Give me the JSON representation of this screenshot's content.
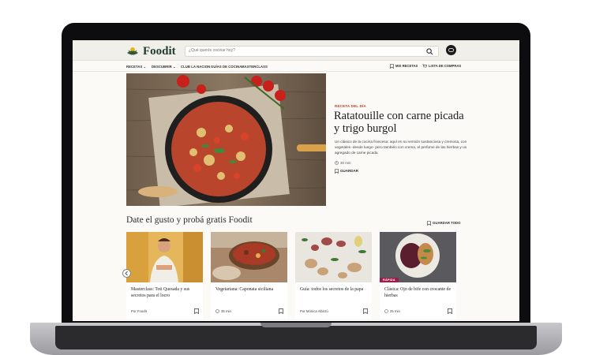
{
  "brand": {
    "name": "Foodit"
  },
  "search": {
    "placeholder": "¿Qué querés cocinar hoy?"
  },
  "nav": {
    "items": [
      "RECETAS",
      "DESCUBRIR",
      "CLUB LA NACION",
      "GUÍAS DE COCINA",
      "MASTERCLASS"
    ],
    "my_recipes": "MIS RECETAS",
    "shopping_list": "LISTA DE COMPRAS"
  },
  "hero": {
    "kicker": "RECETA DEL DÍA",
    "title": "Ratatouille con carne picada y trigo burgol",
    "description": "Un clásico de la cocina francesa: aquí en su versión sustanciosa y cremosa, con vegetales -desde luego- pero también con crema, el perfume de las hierbas y un agregado de carne picada",
    "time": "30 min",
    "save_label": "GUARDAR"
  },
  "section": {
    "title": "Date el gusto y probá gratis Foodit",
    "save_all": "GUARDAR TODO"
  },
  "cards": [
    {
      "title": "Masterclass: Toti Quesada y sus secretos para el locro",
      "meta": "Por Foodit"
    },
    {
      "title": "Vegetariana: Caponata siciliana",
      "meta": "35 min"
    },
    {
      "title": "Guía: todos los secretos de la papa",
      "meta": "Por Mónica Albirzú"
    },
    {
      "title": "Clásica: Ojo de bife con crocante de hierbas",
      "meta": "25 min",
      "badge": "RÁPIDA"
    }
  ],
  "colors": {
    "accent_red": "#b5402e",
    "brand_green": "#1f3d2b",
    "badge_magenta": "#9b1f4a"
  },
  "icons": [
    "logo-leaf-icon",
    "search-icon",
    "user-icon",
    "chevron-down-icon",
    "bookmark-icon",
    "clock-icon",
    "chevron-left-icon"
  ]
}
